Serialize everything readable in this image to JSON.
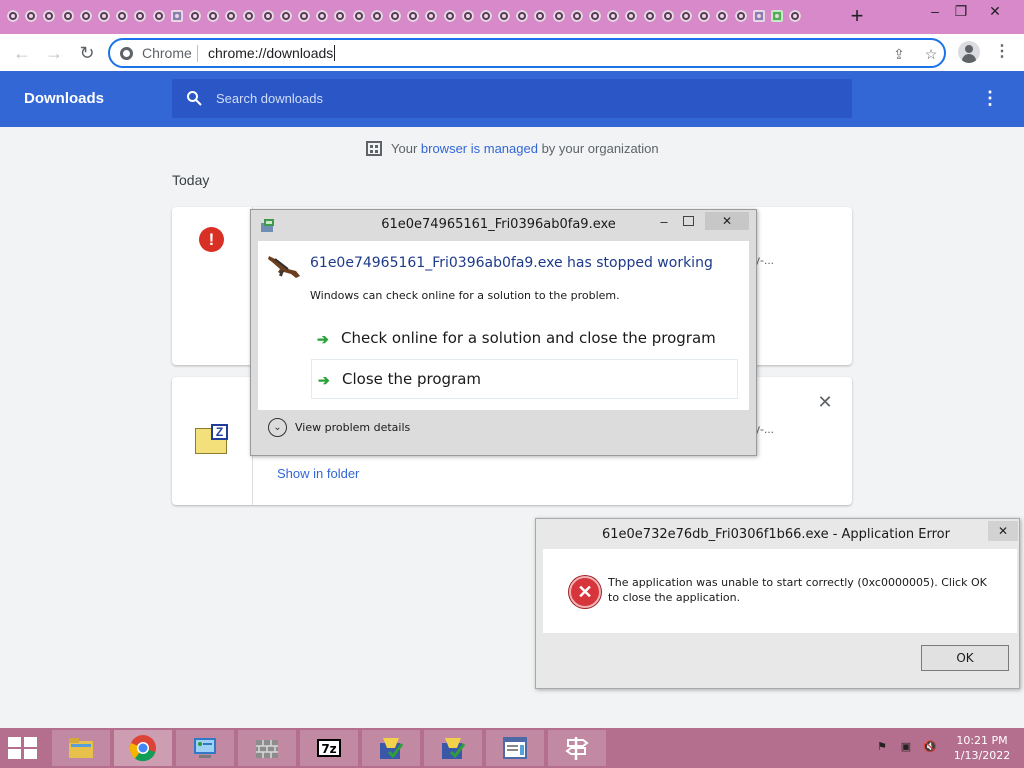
{
  "browser": {
    "omnibox_label": "Chrome",
    "omnibox_url": "chrome://downloads",
    "new_tab_glyph": "+",
    "window_buttons": {
      "minimize": "–",
      "restore": "❐",
      "close": "✕"
    }
  },
  "downloads": {
    "title": "Downloads",
    "search_placeholder": "Search downloads",
    "managed_prefix": "Your ",
    "managed_link": "browser is managed",
    "managed_suffix": " by your organization",
    "section_today": "Today",
    "items": [
      {
        "status": "error",
        "icon": "error-icon",
        "trailing_text": "y-..."
      },
      {
        "icon": "7zip-file-icon",
        "trailing_text": "y-...",
        "action": "Show in folder"
      }
    ]
  },
  "crash_dialog": {
    "title": "61e0e74965161_Fri0396ab0fa9.exe",
    "heading": "61e0e74965161_Fri0396ab0fa9.exe has stopped working",
    "subtext": "Windows can check online for a solution to the problem.",
    "option_check": "Check online for a solution and close the program",
    "option_close": "Close the program",
    "details": "View problem details"
  },
  "app_error": {
    "title": "61e0e732e76db_Fri0306f1b66.exe - Application Error",
    "message": "The application was unable to start correctly (0xc0000005). Click OK to close the application.",
    "ok_label": "OK"
  },
  "taskbar": {
    "time": "10:21 PM",
    "date": "1/13/2022",
    "items": [
      "file-explorer",
      "chrome",
      "control-panel",
      "firewall",
      "7zip",
      "setup-installer",
      "setup-installer",
      "document-viewer",
      "network-tool"
    ]
  },
  "colors": {
    "tabstrip": "#d889c9",
    "header": "#3367d6",
    "accent": "#1a73e8",
    "taskbar": "#b56f8e",
    "error_red": "#d93025"
  }
}
